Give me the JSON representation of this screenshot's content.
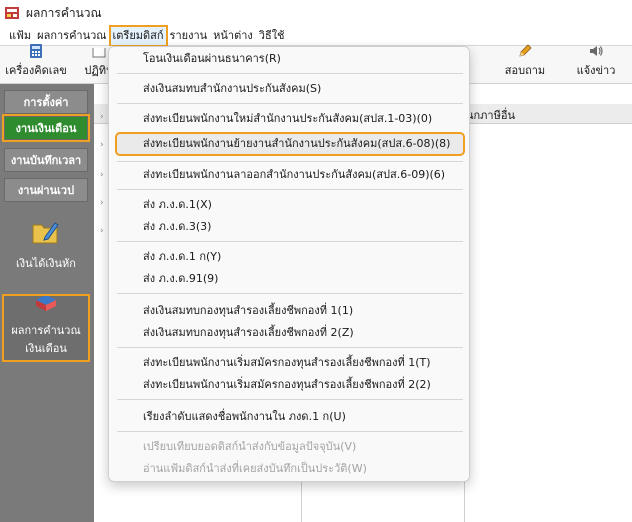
{
  "window": {
    "title": "ผลการคำนวณ"
  },
  "menubar": {
    "items": [
      "แฟ้ม",
      "ผลการคำนวณ",
      "เตรียมดิสก์",
      "รายงาน",
      "หน้าต่าง",
      "วิธีใช้"
    ]
  },
  "toolbar": {
    "calculator": "เครื่องคิดเลข",
    "calendar": "ปฏิทิน",
    "ask": "สอบถาม",
    "notify": "แจ้งข่าว"
  },
  "sidebar": {
    "tabs": [
      "การตั้งค่า",
      "งานเงินเดือน",
      "งานบันทึกเวลา",
      "งานผ่านเวป"
    ],
    "income_deduct": "เงินได้เงินหัก",
    "payroll_calc_line1": "ผลการคำนวณ",
    "payroll_calc_line2": "เงินเดือน"
  },
  "main": {
    "column_text": "นกภาษีอื่น"
  },
  "dropdown": {
    "items": [
      {
        "label": "โอนเงินเดือนผ่านธนาคาร(R)",
        "disabled": false
      },
      {
        "label": "ส่งเงินสมทบสำนักงานประกันสังคม(S)",
        "disabled": false
      },
      {
        "label": "ส่งทะเบียนพนักงานใหม่สำนักงานประกันสังคม(สปส.1-03)(0)",
        "disabled": false
      },
      {
        "label": "ส่งทะเบียนพนักงานย้ายงานสำนักงานประกันสังคม(สปส.6-08)(8)",
        "disabled": false
      },
      {
        "label": "ส่งทะเบียนพนักงานลาออกสำนักงานประกันสังคม(สปส.6-09)(6)",
        "disabled": false
      },
      {
        "label": "ส่ง ภ.ง.ด.1(X)",
        "disabled": false
      },
      {
        "label": "ส่ง ภ.ง.ด.3(3)",
        "disabled": false
      },
      {
        "label": "ส่ง ภ.ง.ด.1 ก(Y)",
        "disabled": false
      },
      {
        "label": "ส่ง ภ.ง.ด.91(9)",
        "disabled": false
      },
      {
        "label": "ส่งเงินสมทบกองทุนสำรองเลี้ยงชีพกองที่ 1(1)",
        "disabled": false
      },
      {
        "label": "ส่งเงินสมทบกองทุนสำรองเลี้ยงชีพกองที่ 2(Z)",
        "disabled": false
      },
      {
        "label": "ส่งทะเบียนพนักงานเริ่มสมัครกองทุนสำรองเลี้ยงชีพกองที่ 1(T)",
        "disabled": false
      },
      {
        "label": "ส่งทะเบียนพนักงานเริ่มสมัครกองทุนสำรองเลี้ยงชีพกองที่ 2(2)",
        "disabled": false
      },
      {
        "label": "เรียงลำดับแสดงชื่อพนักงานใน  ภงด.1 ก(U)",
        "disabled": false
      },
      {
        "label": "เปรียบเทียบยอดดิสก์นำส่งกับข้อมูลปัจจุบัน(V)",
        "disabled": true
      },
      {
        "label": "อ่านแฟ้มดิสก์นำส่งที่เคยส่งบันทึกเป็นประวัติ(W)",
        "disabled": true
      }
    ]
  },
  "colors": {
    "highlight": "#f0a020",
    "active_tab": "#2e8b2e",
    "sidebar": "#7a7a7a"
  }
}
